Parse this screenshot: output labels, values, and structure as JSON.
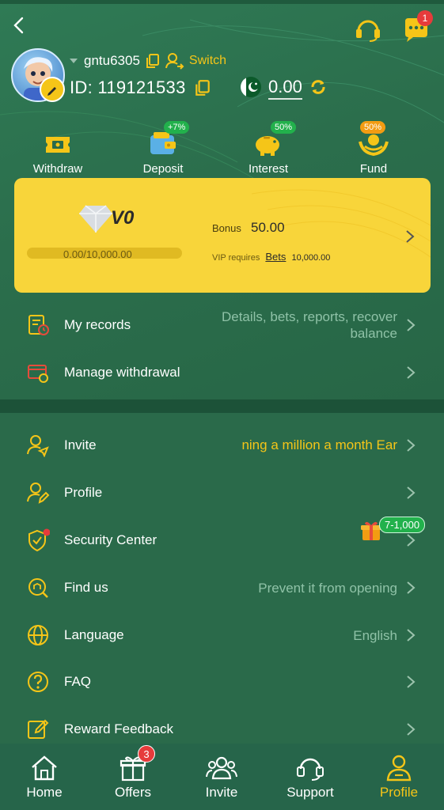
{
  "colors": {
    "accent": "#f5c518",
    "background": "#2a6a4a",
    "badge": "#e63b3b",
    "promo_green": "#22b14c"
  },
  "header": {
    "username": "gntu6305",
    "switch_label": "Switch",
    "user_id": "ID: 119121533",
    "balance": "0.00",
    "message_badge": "1"
  },
  "quick_actions": [
    {
      "label": "Withdraw",
      "icon": "ticket-icon"
    },
    {
      "label": "Deposit",
      "icon": "wallet-icon",
      "badge": "+7%"
    },
    {
      "label": "Interest",
      "icon": "piggy-bank-icon",
      "badge": "50%"
    },
    {
      "label": "Fund",
      "icon": "hands-coin-icon",
      "badge": "50%"
    }
  ],
  "vip": {
    "level": "V0",
    "progress_text": "0.00/10,000.00",
    "progress_fraction": 0,
    "bonus_label": "Bonus",
    "bonus_value": "50.00",
    "requires_prefix": "VIP requires",
    "requires_link": "Bets",
    "requires_amount": "10,000.00"
  },
  "records": [
    {
      "label": "My records",
      "value_line1": "Details, bets, reports, recover",
      "value_line2": "balance"
    },
    {
      "label": "Manage withdrawal",
      "value": ""
    }
  ],
  "menu": [
    {
      "label": "Invite",
      "value": "ning a million a month  Ear"
    },
    {
      "label": "Profile",
      "value": ""
    },
    {
      "label": "Security Center",
      "value": "",
      "promo": "7-1,000"
    },
    {
      "label": "Find us",
      "value": "Prevent it from opening"
    },
    {
      "label": "Language",
      "value": "English"
    },
    {
      "label": "FAQ",
      "value": ""
    },
    {
      "label": "Reward Feedback",
      "value": ""
    }
  ],
  "bottom_nav": [
    {
      "label": "Home"
    },
    {
      "label": "Offers",
      "badge": "3"
    },
    {
      "label": "Invite"
    },
    {
      "label": "Support"
    },
    {
      "label": "Profile",
      "active": true
    }
  ]
}
